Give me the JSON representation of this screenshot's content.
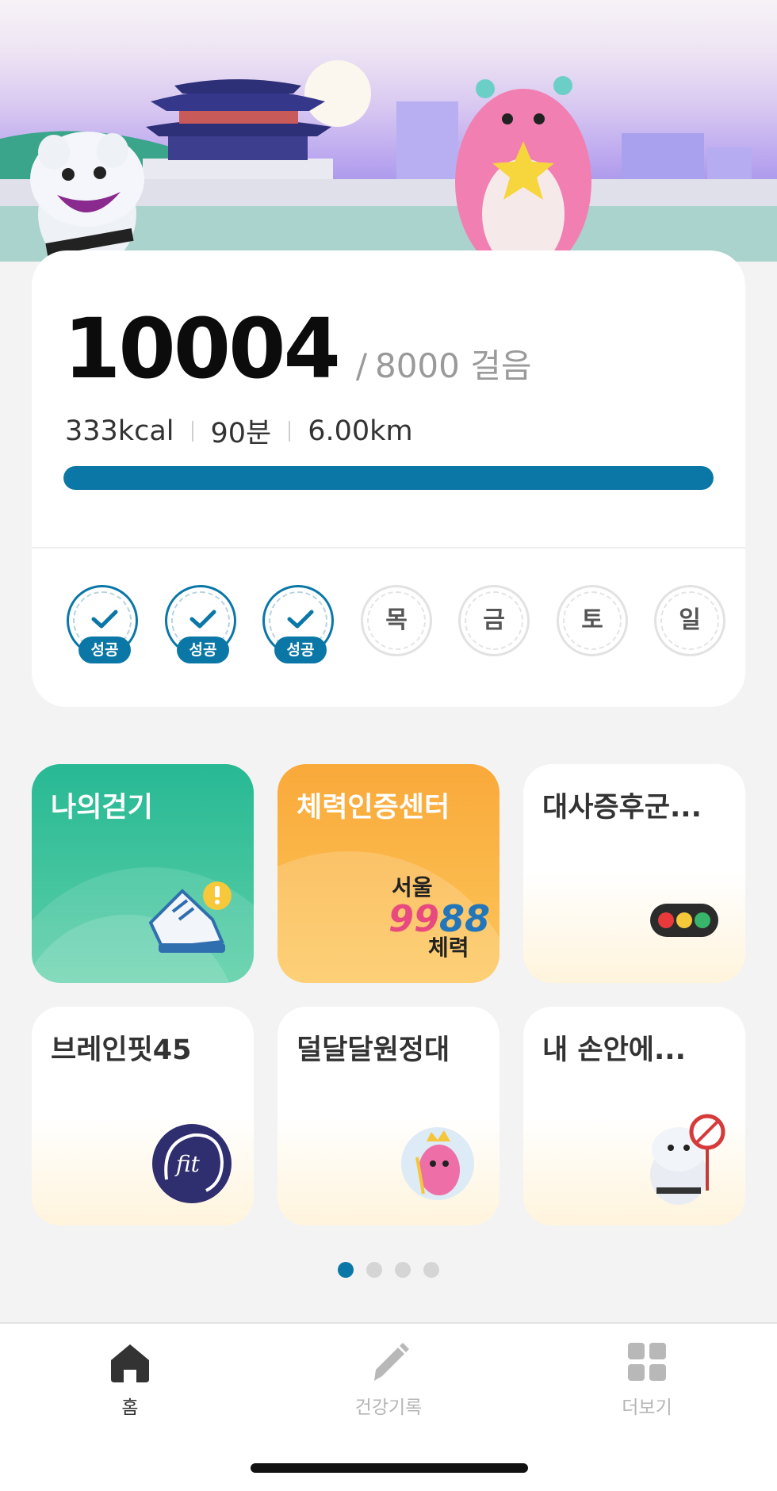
{
  "steps": {
    "count": "10004",
    "goal_prefix": "/",
    "goal": "8000 걸음",
    "progress_fraction": 1.0
  },
  "stats": {
    "kcal": "333kcal",
    "minutes": "90분",
    "distance": "6.00km"
  },
  "week": [
    {
      "status": "success",
      "badge": "성공"
    },
    {
      "status": "success",
      "badge": "성공"
    },
    {
      "status": "success",
      "badge": "성공"
    },
    {
      "status": "pending",
      "label": "목"
    },
    {
      "status": "pending",
      "label": "금"
    },
    {
      "status": "pending",
      "label": "토"
    },
    {
      "status": "pending",
      "label": "일"
    }
  ],
  "tiles": [
    {
      "label": "나의걷기",
      "icon": "sneaker-icon"
    },
    {
      "label": "체력인증센터",
      "logo_text": [
        "서울",
        "99",
        "88",
        "체력"
      ]
    },
    {
      "label": "대사증후군...",
      "icon": "traffic-light-icon"
    },
    {
      "label": "브레인핏45",
      "icon": "fit-logo-icon",
      "logo_text": "fit"
    },
    {
      "label": "덜달달원정대",
      "icon": "mascot-crown-icon"
    },
    {
      "label": "내 손안에...",
      "icon": "no-smoking-mascot-icon"
    }
  ],
  "pager": {
    "pages": 4,
    "active": 0
  },
  "nav": {
    "home": "홈",
    "health_record": "건강기록",
    "more": "더보기"
  },
  "colors": {
    "accent": "#0b77a7",
    "green_tile": "#27b994",
    "orange_tile": "#f9a93a"
  }
}
